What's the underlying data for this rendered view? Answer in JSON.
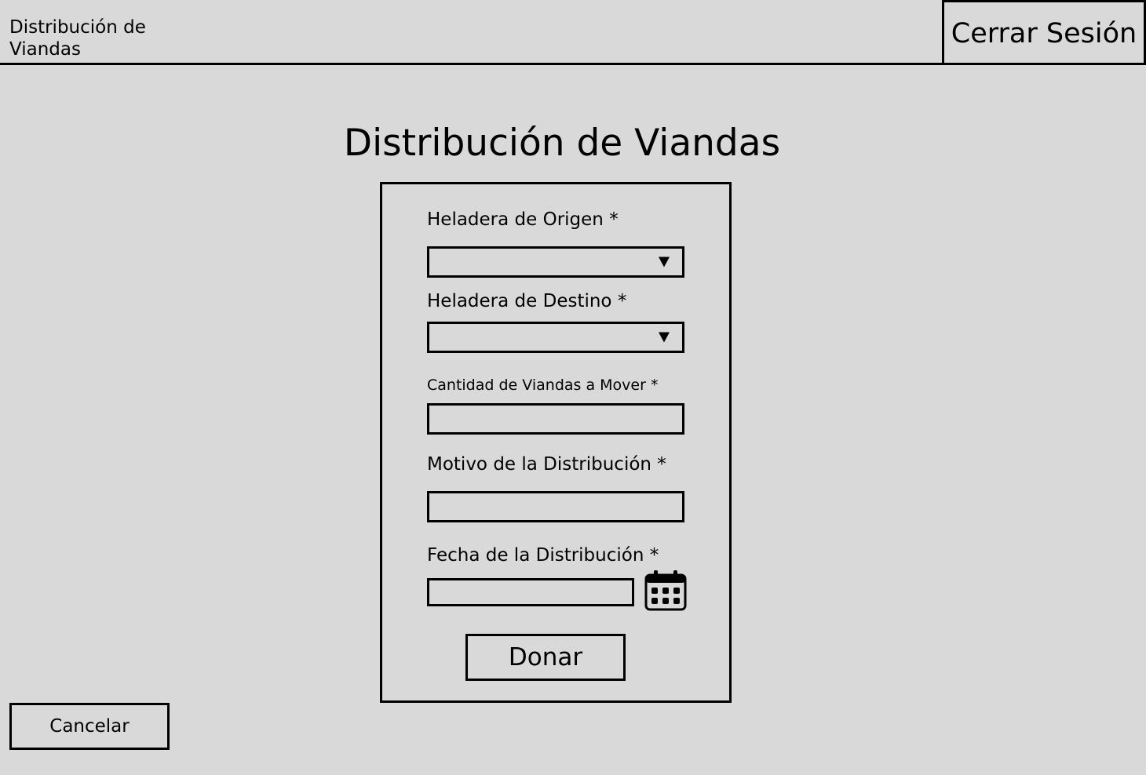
{
  "header": {
    "brand_title": "Distribución de Viandas",
    "logout_label": "Cerrar Sesión"
  },
  "main": {
    "title": "Distribución de Viandas"
  },
  "form": {
    "origin": {
      "label": "Heladera de Origen *",
      "value": ""
    },
    "destination": {
      "label": "Heladera de Destino *",
      "value": ""
    },
    "quantity": {
      "label": "Cantidad de Viandas a Mover *",
      "value": ""
    },
    "reason": {
      "label": "Motivo de la Distribución *",
      "value": ""
    },
    "date": {
      "label": "Fecha de la Distribución *",
      "value": "",
      "icon": "calendar-icon"
    },
    "submit_label": "Donar"
  },
  "footer": {
    "cancel_label": "Cancelar"
  }
}
